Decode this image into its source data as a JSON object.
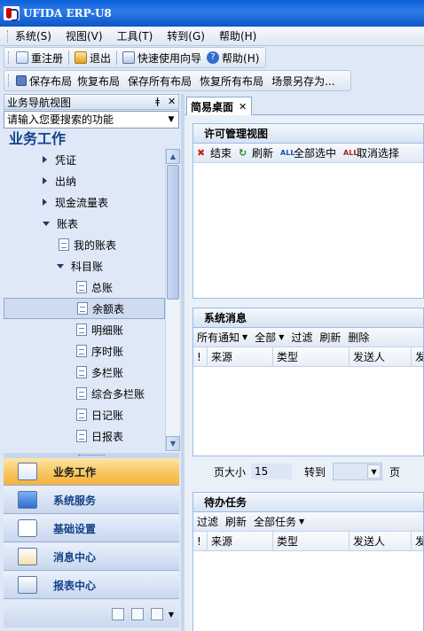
{
  "window": {
    "title": "UFIDA ERP-U8"
  },
  "menu": [
    "系统(S)",
    "视图(V)",
    "工具(T)",
    "转到(G)",
    "帮助(H)"
  ],
  "toolbar1": {
    "register": "重注册",
    "exit": "退出",
    "quickstart": "快速使用向导",
    "help": "帮助(H)"
  },
  "toolbar2": [
    "保存布局",
    "恢复布局",
    "保存所有布局",
    "恢复所有布局",
    "场景另存为..."
  ],
  "nav": {
    "header": "业务导航视图",
    "pin": "ǂ",
    "close": "✕",
    "search_placeholder": "请输入您要搜索的功能",
    "section": "业务工作",
    "items": [
      {
        "label": "凭证",
        "level": 1,
        "type": "collapsed"
      },
      {
        "label": "出纳",
        "level": 1,
        "type": "collapsed"
      },
      {
        "label": "现金流量表",
        "level": 1,
        "type": "collapsed"
      },
      {
        "label": "账表",
        "level": 1,
        "type": "expanded"
      },
      {
        "label": "我的账表",
        "level": 2,
        "type": "doc"
      },
      {
        "label": "科目账",
        "level": 2,
        "type": "expanded"
      },
      {
        "label": "总账",
        "level": 3,
        "type": "doc"
      },
      {
        "label": "余额表",
        "level": 3,
        "type": "doc",
        "selected": true
      },
      {
        "label": "明细账",
        "level": 3,
        "type": "doc"
      },
      {
        "label": "序时账",
        "level": 3,
        "type": "doc"
      },
      {
        "label": "多栏账",
        "level": 3,
        "type": "doc"
      },
      {
        "label": "综合多栏账",
        "level": 3,
        "type": "doc"
      },
      {
        "label": "日记账",
        "level": 3,
        "type": "doc"
      },
      {
        "label": "日报表",
        "level": 3,
        "type": "doc"
      }
    ],
    "buttons": [
      {
        "label": "业务工作",
        "icon": "chart-icon",
        "active": true
      },
      {
        "label": "系统服务",
        "icon": "monitor-icon"
      },
      {
        "label": "基础设置",
        "icon": "gear-icon"
      },
      {
        "label": "消息中心",
        "icon": "mail-icon"
      },
      {
        "label": "报表中心",
        "icon": "report-icon"
      }
    ]
  },
  "tab": {
    "label": "简易桌面",
    "close": "✕"
  },
  "license_panel": {
    "title": "许可管理视图",
    "tools": [
      "结束",
      "刷新",
      "全部选中",
      "取消选择"
    ]
  },
  "message_panel": {
    "title": "系统消息",
    "tools": [
      "所有通知",
      "全部",
      "过滤",
      "刷新",
      "删除"
    ],
    "columns": [
      "!",
      "来源",
      "类型",
      "发送人",
      "发"
    ]
  },
  "pager": {
    "page_size_label": "页大小",
    "page_size": "15",
    "goto_label": "转到",
    "page_unit": "页"
  },
  "todo_panel": {
    "title": "待办任务",
    "tools": [
      "过滤",
      "刷新",
      "全部任务"
    ],
    "columns": [
      "!",
      "来源",
      "类型",
      "发送人",
      "发"
    ]
  }
}
